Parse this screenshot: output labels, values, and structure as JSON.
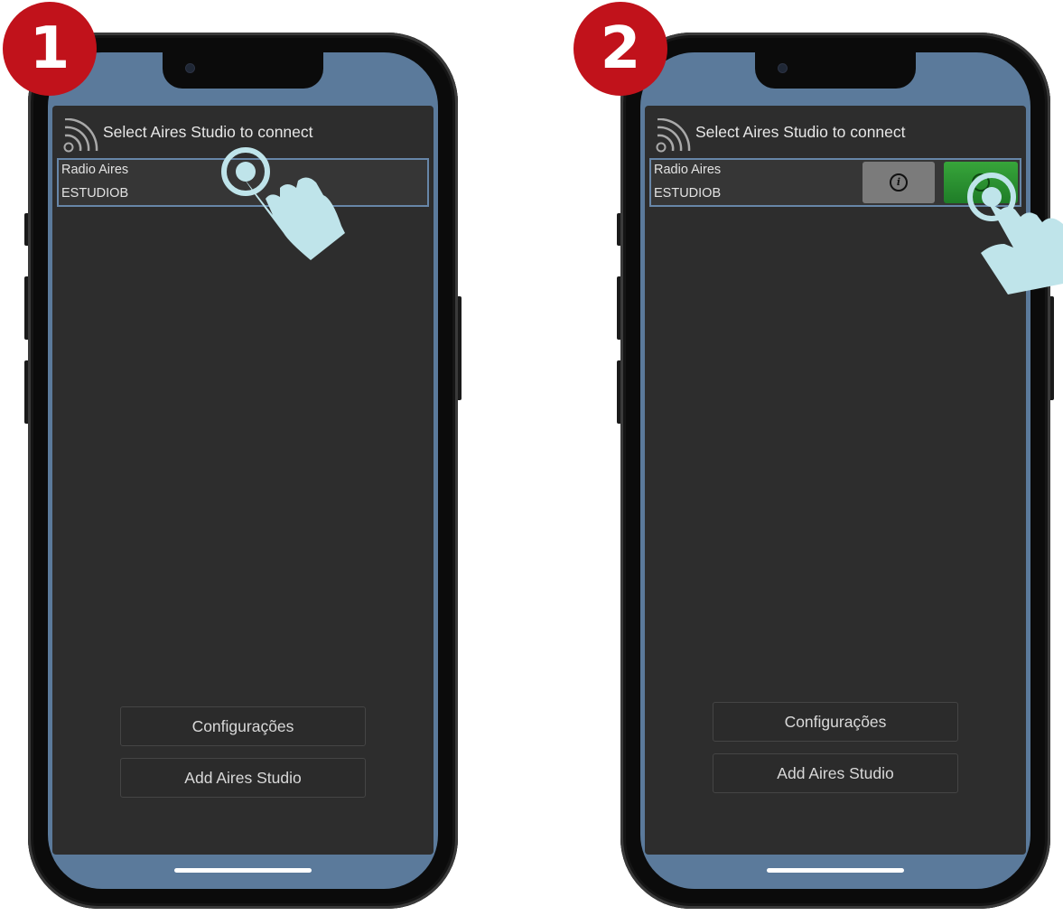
{
  "steps": [
    {
      "badge": "1",
      "header_title": "Select Aires Studio to connect",
      "studio": {
        "name": "Radio Aires",
        "id": "ESTUDIOB"
      },
      "buttons": {
        "settings": "Configurações",
        "add": "Add Aires Studio"
      },
      "icons": [
        "wifi-icon",
        "tap-hand-icon"
      ]
    },
    {
      "badge": "2",
      "header_title": "Select Aires Studio to connect",
      "studio": {
        "name": "Radio Aires",
        "id": "ESTUDIOB"
      },
      "buttons": {
        "settings": "Configurações",
        "add": "Add Aires Studio"
      },
      "icons": [
        "wifi-icon",
        "info-icon",
        "power-icon",
        "tap-hand-icon"
      ]
    }
  ],
  "colors": {
    "badge": "#c1121b",
    "screen_background": "#5b7a9b",
    "app_background": "#2d2d2d",
    "row_border": "#6786a8",
    "connect_button": "#2e8f33",
    "info_button": "#7b7b7b",
    "tap_hand": "#bfe4ea"
  }
}
